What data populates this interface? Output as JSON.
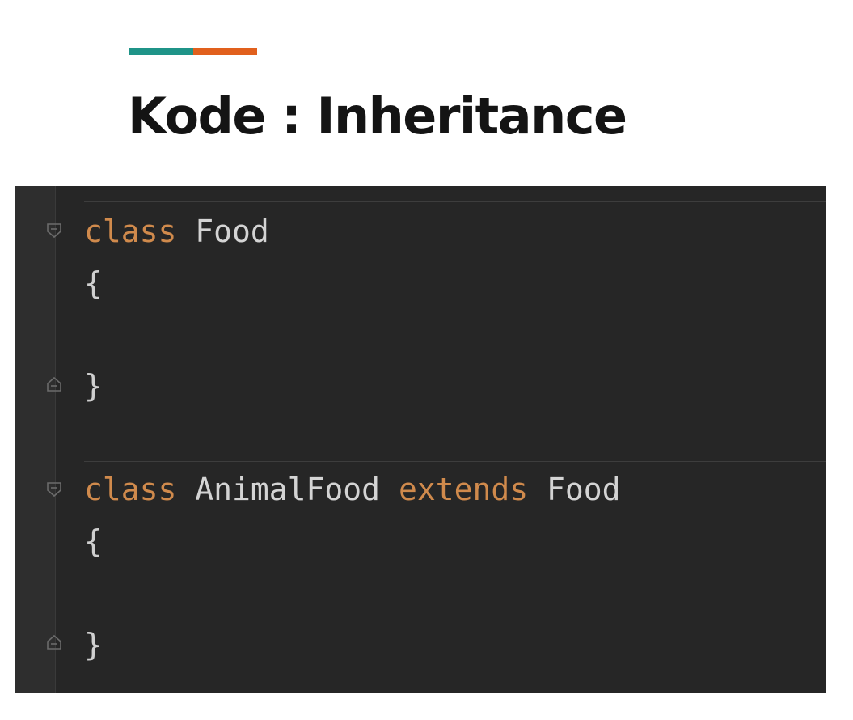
{
  "slide": {
    "title": "Kode : Inheritance",
    "accent_colors": {
      "left": "#1f9488",
      "right": "#e1601d"
    }
  },
  "editor": {
    "background": "#262626",
    "keyword_color": "#d08a4c",
    "text_color": "#d4d4d4",
    "code_lines": [
      {
        "keyword1": "class",
        "name": "Food"
      },
      {
        "text": "{"
      },
      {
        "text": "}"
      },
      {
        "keyword1": "class",
        "name": "AnimalFood",
        "keyword2": "extends",
        "parent": "Food"
      },
      {
        "text": "{"
      },
      {
        "text": "}"
      }
    ],
    "fold_icons": [
      "fold-collapse-icon",
      "fold-end-icon",
      "fold-collapse-icon",
      "fold-end-icon"
    ]
  }
}
